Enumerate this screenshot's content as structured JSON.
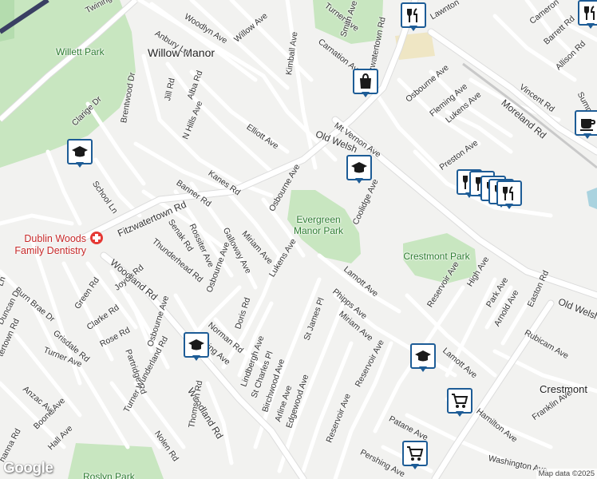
{
  "map": {
    "place_label": "Willow Manor",
    "business_label": "Dublin Woods Family Dentistry",
    "attribution": "Map data ©2025",
    "logo": "Google",
    "parks": [
      {
        "id": "evergreen",
        "label": "Evergreen Manor Park"
      },
      {
        "id": "crestmont",
        "label": "Crestmont Park"
      },
      {
        "id": "willett",
        "label": "Willett Park"
      },
      {
        "id": "roslyn",
        "label": "Roslyn Park"
      }
    ],
    "cities": [
      {
        "id": "crestmont-city",
        "label": "Crestmont"
      }
    ],
    "streets": [
      "Twining Rd",
      "Woodlyn Ave",
      "Willow Ave",
      "Anbury Ln",
      "Kimball Ave",
      "Turner Ave",
      "Smith Ave",
      "Carnation Ave",
      "Fitzwatertown Rd",
      "Lawnton",
      "Cameron",
      "Barrett Rd",
      "Allison Rd",
      "Summit Ave",
      "Vincent Rd",
      "Osbourne Ave",
      "Fleming Ave",
      "Lukens Ave",
      "Moreland Rd",
      "Jill Rd",
      "Alba Rd",
      "Brentwood Dr",
      "Clarige Dr",
      "Mt Vernon Ave",
      "Elliott Ave",
      "N Hills Ave",
      "Old Welsh",
      "Preston Ave",
      "Kanes Rd",
      "School Ln",
      "Banner Rd",
      "Osbourne Ave",
      "Coolidge Ave",
      "Fitzwatertown Rd",
      "Rossiter Ave",
      "Galloway Ave",
      "Miriam Ave",
      "Senak Rd",
      "Thunderhead Rd",
      "Lukens Ave",
      "Lamott Ave",
      "Woodland Rd",
      "Osbourne Ave",
      "Reservoir Ave",
      "High Ave",
      "Old Welsh",
      "Burn Brae Dr",
      "Green Rd",
      "Joyce Rd",
      "Phipps Ave",
      "Park Ave",
      "Easton Rd",
      "Arnold Ave",
      "Duncan Dr",
      "Clarke Rd",
      "Doris Rd",
      "Norman Rd",
      "Miriam Ave",
      "Rubicam Ave",
      "St James Pl",
      "Grisdale Rd",
      "Rose Rd",
      "Partridge Rd",
      "Osbourne Ave",
      "Lamott Ave",
      "Turner Ave",
      "tertown Rd",
      "Reservoir Ave",
      "Lindbergh Ave",
      "St Charles Pl",
      "Anzac Ave",
      "Turner Wunderland Rd",
      "Woodland Rd",
      "Birchwood Ave",
      "Thomson Rd",
      "Hamilton Ave",
      "Arline Ave",
      "Nolen Rd",
      "Edgewood Ave",
      "Boone Ave",
      "Franklin Ave",
      "Reservoir Ave",
      "Patane Ave",
      "Hall Ave",
      "Washington Ave",
      "hanna Rd",
      "Pershing Ave",
      "Ln",
      "ching Ave"
    ],
    "pois": [
      {
        "type": "restaurant",
        "icon": "restaurant-icon"
      },
      {
        "type": "shopping",
        "icon": "shopping-bag-icon"
      },
      {
        "type": "school",
        "icon": "school-icon"
      },
      {
        "type": "school",
        "icon": "school-icon"
      },
      {
        "type": "school",
        "icon": "school-icon"
      },
      {
        "type": "school",
        "icon": "school-icon"
      },
      {
        "type": "restaurant",
        "icon": "restaurant-icon"
      },
      {
        "type": "restaurant",
        "icon": "restaurant-icon"
      },
      {
        "type": "restaurant",
        "icon": "restaurant-icon"
      },
      {
        "type": "restaurant",
        "icon": "restaurant-icon"
      },
      {
        "type": "restaurant",
        "icon": "restaurant-icon"
      },
      {
        "type": "grocery",
        "icon": "shopping-cart-icon"
      },
      {
        "type": "grocery",
        "icon": "shopping-cart-icon"
      },
      {
        "type": "cafe",
        "icon": "coffee-cup-icon"
      },
      {
        "type": "medical",
        "icon": "medical-cross-icon"
      }
    ],
    "colors": {
      "background": "#f2f2f0",
      "road": "#ffffff",
      "major_road": "#ffffff",
      "road_outline": "#dcdcdc",
      "park": "#c8e6c0",
      "park_text": "#2e7d32",
      "poi_border": "#1d5c96",
      "business_text": "#c62828",
      "rail": "#b8b8b8",
      "water": "#aad3df"
    }
  }
}
